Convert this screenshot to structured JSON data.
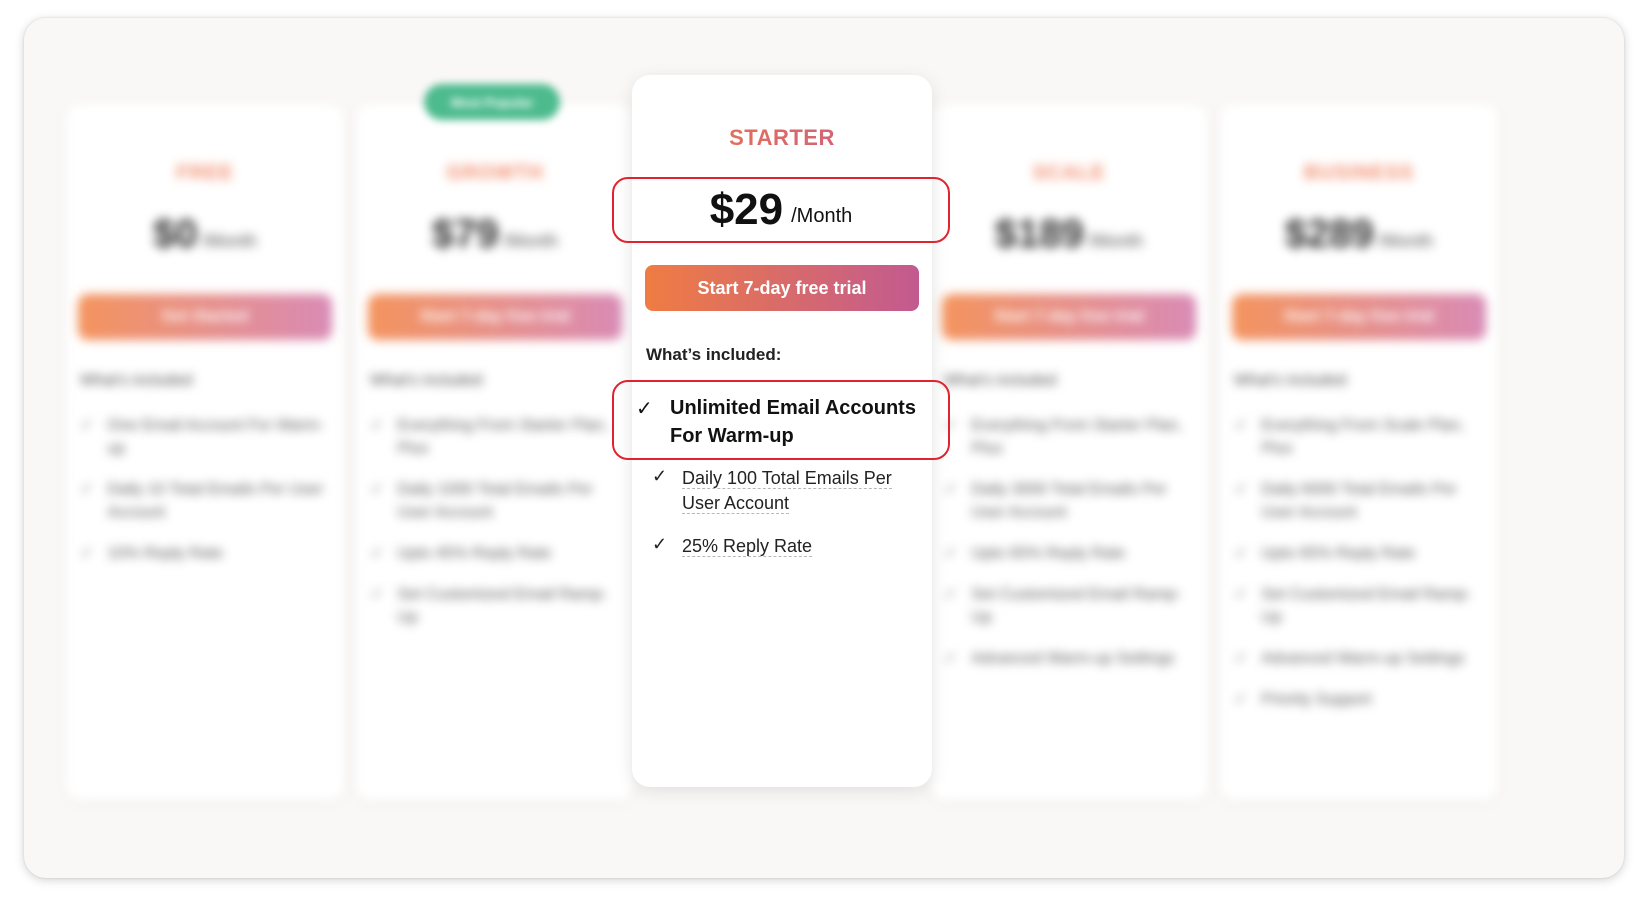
{
  "plans_blurred": [
    {
      "name": "FREE",
      "price": "$0",
      "period": "/Month",
      "cta": "Get Started",
      "included": "What's included",
      "features": [
        "One Email Account For Warm-up",
        "Daily 10 Total Emails Per User Account",
        "10% Reply Rate"
      ]
    },
    {
      "name": "GROWTH",
      "price": "$79",
      "period": "/Month",
      "cta": "Start 7-day free trial",
      "included": "What's included",
      "features": [
        "Everything From Starter Plan, Plus",
        "Daily 1000 Total Emails Per User Account",
        "Upto 45% Reply Rate",
        "Set Customized Email Ramp-Up"
      ]
    },
    {
      "name": "SCALE",
      "price": "$189",
      "period": "/Month",
      "cta": "Start 7-day free trial",
      "included": "What's included",
      "features": [
        "Everything From Starter Plan, Plus",
        "Daily 3000 Total Emails Per User Account",
        "Upto 65% Reply Rate",
        "Set Customized Email Ramp-Up",
        "Advanced Warm-up Settings"
      ]
    },
    {
      "name": "BUSINESS",
      "price": "$289",
      "period": "/Month",
      "cta": "Start 7-day free trial",
      "included": "What's included",
      "features": [
        "Everything From Scale Plan, Plus",
        "Daily 6000 Total Emails Per User Account",
        "Upto 65% Reply Rate",
        "Set Customized Email Ramp-Up",
        "Advanced Warm-up Settings",
        "Priority Support"
      ]
    }
  ],
  "badge": "Most Popular",
  "starter": {
    "name": "STARTER",
    "price": "$29",
    "period": "/Month",
    "cta": "Start 7-day free trial",
    "included_label": "What’s included:",
    "highlight_feature": "Unlimited Email Accounts For Warm-up",
    "features": [
      "Daily 100 Total Emails Per User Account",
      "25% Reply Rate"
    ]
  },
  "check_glyph": "✓",
  "colors": {
    "highlight_border": "#e0242f",
    "gradient_start": "#ef7c43",
    "gradient_end": "#c25a90",
    "badge": "#4dbb8e"
  }
}
